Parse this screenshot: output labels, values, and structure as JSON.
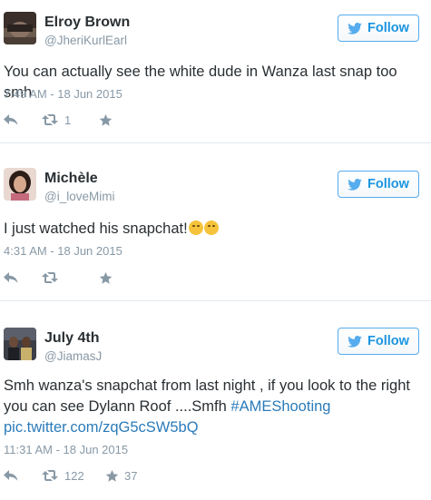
{
  "tweets": [
    {
      "name": "Elroy Brown",
      "handle": "@JheriKurlEarl",
      "follow_label": "Follow",
      "text": "You can actually see the white dude in Wanza last snap too smh",
      "timestamp": "7:49 AM - 18 Jun 2015",
      "retweets": "1",
      "likes": ""
    },
    {
      "name": "Michèle",
      "handle": "@i_loveMimi",
      "follow_label": "Follow",
      "text": "I just watched his snapchat!",
      "emojis": [
        "tired-face-emoji",
        "relieved-face-emoji"
      ],
      "timestamp": "4:31 AM - 18 Jun 2015",
      "retweets": "",
      "likes": ""
    },
    {
      "name": "July 4th",
      "handle": "@JiamasJ",
      "follow_label": "Follow",
      "text_part1": "Smh wanza's snapchat from last night , if you look to the right you can see Dylann Roof ....Smfh ",
      "hashtag": "#AMEShooting",
      "link": "pic.twitter.com/zqG5cSW5bQ",
      "timestamp": "11:31 AM - 18 Jun 2015",
      "retweets": "122",
      "likes": "37"
    }
  ],
  "colors": {
    "accent": "#55acee",
    "link": "#2b7bb9",
    "muted": "#8899a6",
    "separator": "#e1e8ed"
  },
  "icons": [
    "reply-icon",
    "retweet-icon",
    "like-star-icon",
    "twitter-bird-icon"
  ]
}
